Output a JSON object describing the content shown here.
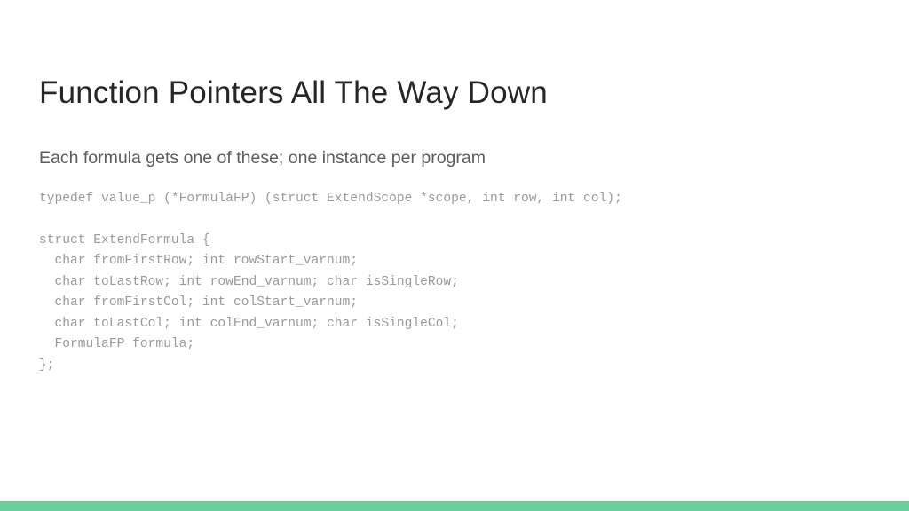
{
  "slide": {
    "title": "Function Pointers All The Way Down",
    "subtitle": "Each formula gets one of these; one instance per program",
    "code_lines": [
      "typedef value_p (*FormulaFP) (struct ExtendScope *scope, int row, int col);",
      "",
      "struct ExtendFormula {",
      "  char fromFirstRow; int rowStart_varnum;",
      "  char toLastRow; int rowEnd_varnum; char isSingleRow;",
      "  char fromFirstCol; int colStart_varnum;",
      "  char toLastCol; int colEnd_varnum; char isSingleCol;",
      "  FormulaFP formula;",
      "};"
    ],
    "colors": {
      "background": "#ffffff",
      "title": "#262626",
      "subtitle": "#5c5c5c",
      "code": "#9a9a9a",
      "accent_bar": "#68d09b"
    }
  }
}
